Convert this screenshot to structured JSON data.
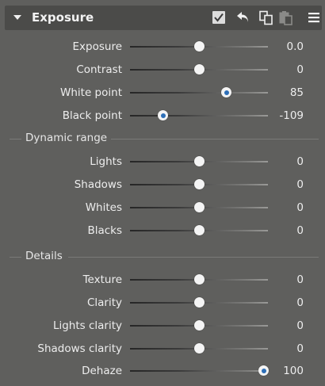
{
  "header": {
    "title": "Exposure",
    "icons": [
      "collapse-arrow",
      "enable-checkbox",
      "reset-icon",
      "copy-icon",
      "paste-icon",
      "menu-icon"
    ]
  },
  "colors": {
    "panel_bg": "#5f5f5d",
    "header_bg": "#4b4b49",
    "accent": "#2d6fb8"
  },
  "main_sliders": [
    {
      "label": "Exposure",
      "value": "0.0",
      "level": 0.5
    },
    {
      "label": "Contrast",
      "value": "0",
      "level": 0.5
    },
    {
      "label": "White point",
      "value": "85",
      "level": 0.7,
      "accent": true
    },
    {
      "label": "Black point",
      "value": "-109",
      "level": 0.24,
      "accent": true
    }
  ],
  "dynamic_range": {
    "title": "Dynamic range",
    "sliders": [
      {
        "label": "Lights",
        "value": "0",
        "level": 0.5
      },
      {
        "label": "Shadows",
        "value": "0",
        "level": 0.5
      },
      {
        "label": "Whites",
        "value": "0",
        "level": 0.5
      },
      {
        "label": "Blacks",
        "value": "0",
        "level": 0.5
      }
    ]
  },
  "details": {
    "title": "Details",
    "sliders": [
      {
        "label": "Texture",
        "value": "0",
        "level": 0.5
      },
      {
        "label": "Clarity",
        "value": "0",
        "level": 0.5
      },
      {
        "label": "Lights clarity",
        "value": "0",
        "level": 0.5
      },
      {
        "label": "Shadows clarity",
        "value": "0",
        "level": 0.5
      },
      {
        "label": "Dehaze",
        "value": "100",
        "level": 0.97,
        "accent": true
      }
    ]
  }
}
